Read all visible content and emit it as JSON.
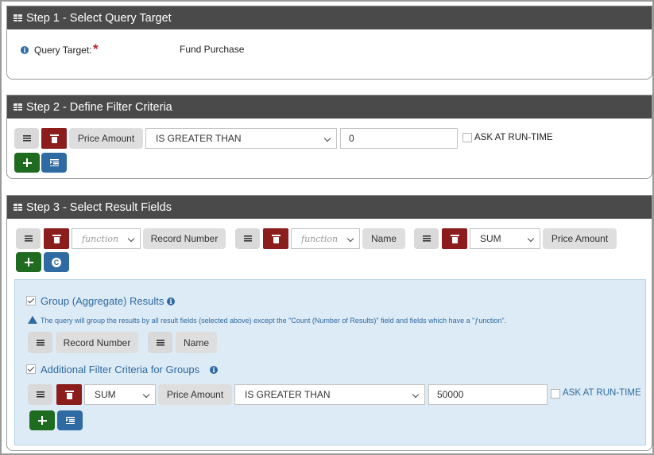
{
  "step1": {
    "title": "Step 1 - Select Query Target",
    "query_target_label": "Query Target:",
    "required_mark": "*",
    "query_target_value": "Fund Purchase"
  },
  "step2": {
    "title": "Step 2 - Define Filter Criteria",
    "filter": {
      "field": "Price Amount",
      "operator": "IS GREATER THAN",
      "value": "0",
      "ask_label": "ASK AT RUN-TIME",
      "ask_checked": false
    }
  },
  "step3": {
    "title": "Step 3 - Select Result Fields",
    "result_fields": [
      {
        "function": "function",
        "field": "Record Number"
      },
      {
        "function": "function",
        "field": "Name"
      },
      {
        "function": "SUM",
        "field": "Price Amount"
      }
    ],
    "group": {
      "checked": true,
      "label": "Group (Aggregate) Results",
      "note": "The query will group the results by all result fields (selected above) except the \"Count (Number of Results)\" field and fields which have a \"ƒunction\".",
      "group_fields": [
        "Record Number",
        "Name"
      ]
    },
    "additional": {
      "checked": true,
      "label": "Additional Filter Criteria for Groups",
      "filter": {
        "function": "SUM",
        "field": "Price Amount",
        "operator": "IS GREATER THAN",
        "value": "50000",
        "ask_label": "ASK AT RUN-TIME",
        "ask_checked": false
      }
    }
  },
  "icons": {
    "info": "i",
    "c_button": "C"
  },
  "colors": {
    "header_bg": "#4a4a4a",
    "delete_red": "#8b1d1d",
    "add_green": "#1f6b1f",
    "accent_blue": "#2f6aa3",
    "aggregate_bg": "#dcebf5"
  }
}
